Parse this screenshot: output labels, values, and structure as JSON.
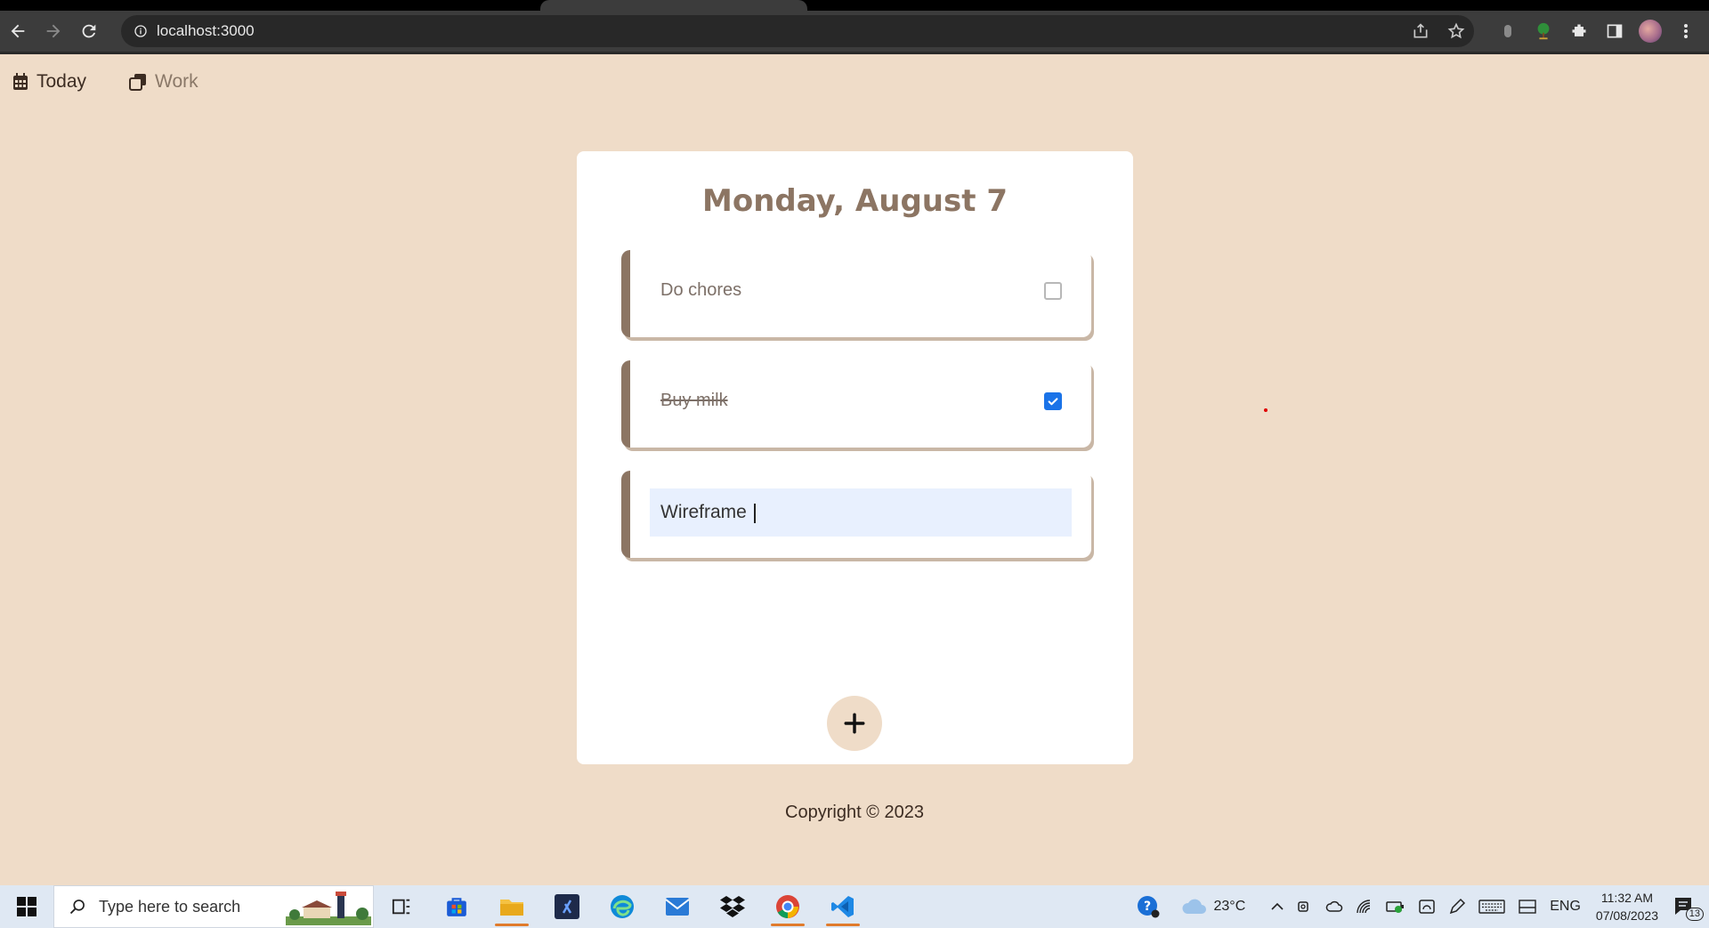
{
  "browser": {
    "url": "localhost:3000"
  },
  "nav": {
    "today_label": "Today",
    "work_label": "Work"
  },
  "card": {
    "title": "Monday, August 7",
    "todos": [
      {
        "text": "Do chores",
        "checked": false
      },
      {
        "text": "Buy milk",
        "checked": true
      }
    ],
    "editing_value": "Wireframe"
  },
  "footer": {
    "copyright": "Copyright © 2023"
  },
  "taskbar": {
    "search_placeholder": "Type here to search",
    "weather": "23°C",
    "language": "ENG",
    "time": "11:32 AM",
    "date": "07/08/2023",
    "notification_count": "13"
  },
  "colors": {
    "page_bg": "#efdcc8",
    "accent_brown": "#8c7563",
    "checkbox_blue": "#1a73e8"
  }
}
